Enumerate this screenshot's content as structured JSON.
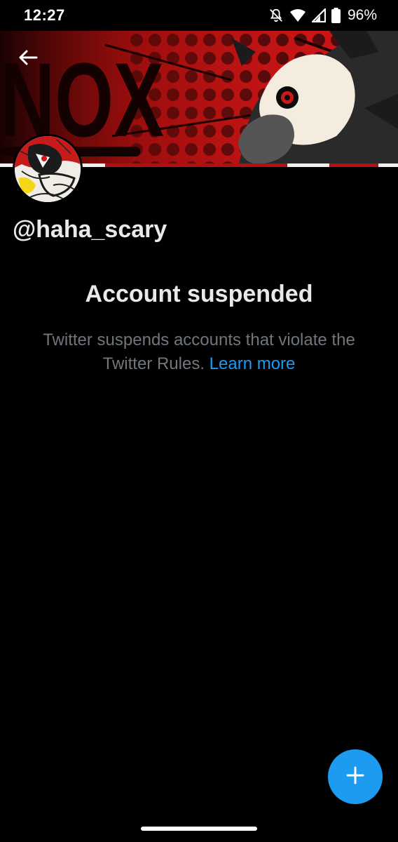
{
  "status_bar": {
    "time": "12:27",
    "battery": "96%",
    "icons": [
      "bell-muted-icon",
      "wifi-icon",
      "signal-icon",
      "battery-icon"
    ]
  },
  "header": {
    "back_icon": "back-arrow-icon",
    "banner_text": "NOX"
  },
  "profile": {
    "handle": "@haha_scary"
  },
  "suspension": {
    "title": "Account suspended",
    "description": "Twitter suspends accounts that violate the Twitter Rules.",
    "link_label": "Learn more"
  },
  "fab": {
    "icon": "plus-icon"
  },
  "colors": {
    "accent": "#1d9bf0",
    "background": "#000000",
    "muted_text": "#71767b",
    "banner_red": "#c41414"
  }
}
